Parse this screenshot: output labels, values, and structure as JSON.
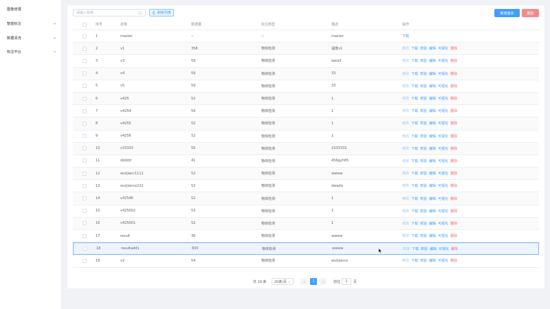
{
  "sidebar": {
    "items": [
      {
        "label": "图像增强",
        "has_chevron": false
      },
      {
        "label": "智能标注",
        "has_chevron": true
      },
      {
        "label": "数据清洗",
        "has_chevron": true
      },
      {
        "label": "标注平台",
        "has_chevron": true
      }
    ]
  },
  "toolbar": {
    "search_placeholder": "请输入名称",
    "reset_label": "刷新列表",
    "add_label": "新增版本",
    "delete_label": "删除"
  },
  "table": {
    "columns": [
      "序号",
      "名称",
      "数据量",
      "标注类型",
      "描述",
      "操作"
    ],
    "selected_index": 17,
    "rows": [
      {
        "idx": "1",
        "name": "master",
        "count": "--",
        "type": "--",
        "desc": "master"
      },
      {
        "idx": "2",
        "name": "v1",
        "count": "358",
        "type": "物体检测",
        "desc": "温度v1"
      },
      {
        "idx": "3",
        "name": "v3",
        "count": "59",
        "type": "物体检测",
        "desc": "data3"
      },
      {
        "idx": "4",
        "name": "v4",
        "count": "59",
        "type": "物体检测",
        "desc": "33"
      },
      {
        "idx": "5",
        "name": "v5",
        "count": "59",
        "type": "物体检测",
        "desc": "33"
      },
      {
        "idx": "6",
        "name": "v425",
        "count": "52",
        "type": "物体检测",
        "desc": "1"
      },
      {
        "idx": "7",
        "name": "v4254",
        "count": "59",
        "type": "物体检测",
        "desc": "1"
      },
      {
        "idx": "8",
        "name": "v4255",
        "count": "52",
        "type": "物体检测",
        "desc": "1"
      },
      {
        "idx": "9",
        "name": "v4256",
        "count": "52",
        "type": "物体检测",
        "desc": "1"
      },
      {
        "idx": "10",
        "name": "v33333",
        "count": "55",
        "type": "物体检测",
        "desc": "2333333"
      },
      {
        "idx": "11",
        "name": "ddddd",
        "count": "41",
        "type": "物体检测",
        "desc": "456gyh65"
      },
      {
        "idx": "12",
        "name": "wutjianc1111",
        "count": "52",
        "type": "物体检测",
        "desc": "wwww"
      },
      {
        "idx": "13",
        "name": "wutjiance222",
        "count": "52",
        "type": "物体检测",
        "desc": "dwqdq"
      },
      {
        "idx": "14",
        "name": "v42546",
        "count": "52",
        "type": "物体检测",
        "desc": "1"
      },
      {
        "idx": "15",
        "name": "v425002",
        "count": "53",
        "type": "物体检测",
        "desc": "1"
      },
      {
        "idx": "16",
        "name": "v425001",
        "count": "52",
        "type": "物体检测",
        "desc": "1"
      },
      {
        "idx": "17",
        "name": "result",
        "count": "36",
        "type": "物体检测",
        "desc": "wwww"
      },
      {
        "idx": "18",
        "name": "resultadd1",
        "count": "600",
        "type": "物体检测",
        "desc": "wwww"
      },
      {
        "idx": "19",
        "name": "v2",
        "count": "54",
        "type": "物体检测",
        "desc": "wutjiance"
      }
    ],
    "first_row_ops": [
      {
        "label": "下载",
        "style": "normal"
      }
    ],
    "row_ops": [
      {
        "label": "修改",
        "style": "faded"
      },
      {
        "label": "下载",
        "style": "normal"
      },
      {
        "label": "校验",
        "style": "normal"
      },
      {
        "label": "编辑",
        "style": "normal"
      },
      {
        "label": "可视化",
        "style": "normal"
      },
      {
        "label": "删除",
        "style": "danger"
      }
    ]
  },
  "pagination": {
    "total_text": "共 19 条",
    "page_size": "20条/页",
    "current_page": "1",
    "goto_label": "前往",
    "goto_value": "1",
    "page_unit": "页"
  },
  "colors": {
    "primary": "#409eff",
    "danger": "#f56c6c",
    "danger_button": "#f78989",
    "selected_row": "#ecf5ff"
  },
  "icons": {
    "search": "search-icon",
    "reset": "refresh-icon",
    "chevron": "chevron-down-icon",
    "cursor": "mouse-cursor-icon"
  }
}
